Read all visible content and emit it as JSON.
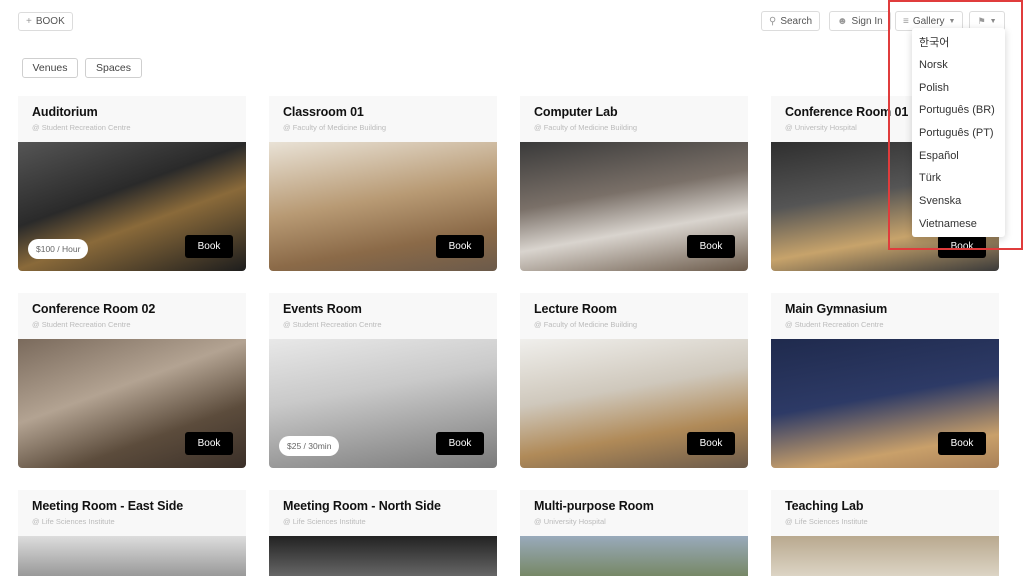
{
  "toolbar": {
    "book_label": "BOOK",
    "search_label": "Search",
    "signin_label": "Sign In",
    "view_label": "Gallery",
    "language_icon": "language-flag-icon"
  },
  "filters": {
    "venues_label": "Venues",
    "spaces_label": "Spaces"
  },
  "language_menu": {
    "options": [
      "한국어",
      "Norsk",
      "Polish",
      "Português (BR)",
      "Português (PT)",
      "Español",
      "Türk",
      "Svenska",
      "Vietnamese"
    ]
  },
  "book_button_label": "Book",
  "spaces": [
    {
      "name": "Auditorium",
      "location": "@ Student Recreation Centre",
      "price": "$100 / Hour"
    },
    {
      "name": "Classroom 01",
      "location": "@ Faculty of Medicine Building",
      "price": null
    },
    {
      "name": "Computer Lab",
      "location": "@ Faculty of Medicine Building",
      "price": null
    },
    {
      "name": "Conference Room 01",
      "location": "@ University Hospital",
      "price": null
    },
    {
      "name": "Conference Room 02",
      "location": "@ Student Recreation Centre",
      "price": null
    },
    {
      "name": "Events Room",
      "location": "@ Student Recreation Centre",
      "price": "$25 / 30min"
    },
    {
      "name": "Lecture Room",
      "location": "@ Faculty of Medicine Building",
      "price": null
    },
    {
      "name": "Main Gymnasium",
      "location": "@ Student Recreation Centre",
      "price": null
    },
    {
      "name": "Meeting Room - East Side",
      "location": "@ Life Sciences Institute",
      "price": null
    },
    {
      "name": "Meeting Room - North Side",
      "location": "@ Life Sciences Institute",
      "price": null
    },
    {
      "name": "Multi-purpose Room",
      "location": "@ University Hospital",
      "price": null
    },
    {
      "name": "Teaching Lab",
      "location": "@ Life Sciences Institute",
      "price": null
    }
  ]
}
